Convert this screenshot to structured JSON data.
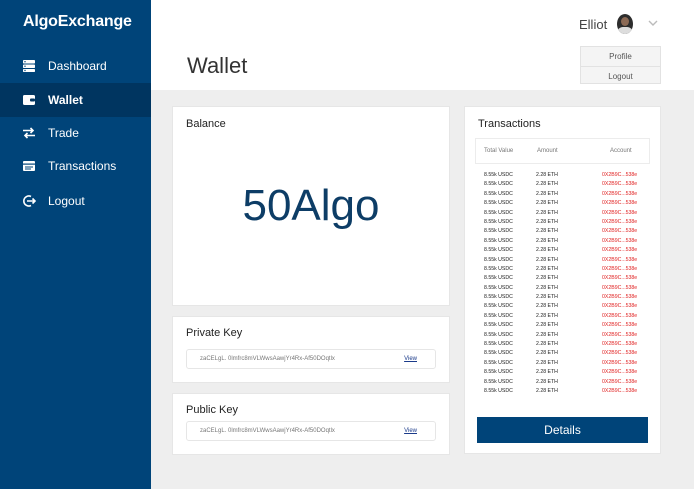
{
  "app": {
    "name": "AlgoExchange"
  },
  "sidebar": {
    "items": [
      {
        "label": "Dashboard",
        "icon": "server-icon"
      },
      {
        "label": "Wallet",
        "icon": "wallet-icon"
      },
      {
        "label": "Trade",
        "icon": "swap-icon"
      },
      {
        "label": "Transactions",
        "icon": "list-icon"
      },
      {
        "label": "Logout",
        "icon": "logout-icon"
      }
    ]
  },
  "header": {
    "page_title": "Wallet",
    "user_name": "Elliot",
    "dropdown": {
      "items": [
        "Profile",
        "Logout"
      ]
    }
  },
  "balance": {
    "title": "Balance",
    "value": "50Algo"
  },
  "private_key": {
    "title": "Private Key",
    "value": "zaCELgL. 0lmfrc8mVLWwsAawjYr4Rx-Af50DOqtlx",
    "link": "View"
  },
  "public_key": {
    "title": "Public Key",
    "value": "zaCELgL. 0lmfrc8mVLWwsAawjYr4Rx-Af50DOqtlx",
    "link": "View"
  },
  "transactions": {
    "title": "Transactions",
    "columns": [
      "Total Value",
      "Amount",
      "Account"
    ],
    "rows": [
      [
        "8.55k USDC",
        "2.28 ETH",
        "0X2B9C...538e"
      ],
      [
        "8.55k USDC",
        "2.28 ETH",
        "0X2B9C...538e"
      ],
      [
        "8.55k USDC",
        "2.28 ETH",
        "0X2B9C...538e"
      ],
      [
        "8.55k USDC",
        "2.28 ETH",
        "0X2B9C...538e"
      ],
      [
        "8.55k USDC",
        "2.28 ETH",
        "0X2B9C...538e"
      ],
      [
        "8.55k USDC",
        "2.28 ETH",
        "0X2B9C...538e"
      ],
      [
        "8.55k USDC",
        "2.28 ETH",
        "0X2B9C...538e"
      ],
      [
        "8.55k USDC",
        "2.28 ETH",
        "0X2B9C...538e"
      ],
      [
        "8.55k USDC",
        "2.28 ETH",
        "0X2B9C...538e"
      ],
      [
        "8.55k USDC",
        "2.28 ETH",
        "0X2B9C...538e"
      ],
      [
        "8.55k USDC",
        "2.28 ETH",
        "0X2B9C...538e"
      ],
      [
        "8.55k USDC",
        "2.28 ETH",
        "0X2B9C...538e"
      ],
      [
        "8.55k USDC",
        "2.28 ETH",
        "0X2B9C...538e"
      ],
      [
        "8.55k USDC",
        "2.28 ETH",
        "0X2B9C...538e"
      ],
      [
        "8.55k USDC",
        "2.28 ETH",
        "0X2B9C...538e"
      ],
      [
        "8.55k USDC",
        "2.28 ETH",
        "0X2B9C...538e"
      ],
      [
        "8.55k USDC",
        "2.28 ETH",
        "0X2B9C...538e"
      ],
      [
        "8.55k USDC",
        "2.28 ETH",
        "0X2B9C...538e"
      ],
      [
        "8.55k USDC",
        "2.28 ETH",
        "0X2B9C...538e"
      ],
      [
        "8.55k USDC",
        "2.28 ETH",
        "0X2B9C...538e"
      ],
      [
        "8.55k USDC",
        "2.28 ETH",
        "0X2B9C...538e"
      ],
      [
        "8.55k USDC",
        "2.28 ETH",
        "0X2B9C...538e"
      ],
      [
        "8.55k USDC",
        "2.28 ETH",
        "0X2B9C...538e"
      ],
      [
        "8.55k USDC",
        "2.28 ETH",
        "0X2B9C...538e"
      ]
    ],
    "details_label": "Details"
  },
  "colors": {
    "sidebar": "#004479",
    "sidebar_active": "#003560",
    "account_text": "#e02020"
  }
}
